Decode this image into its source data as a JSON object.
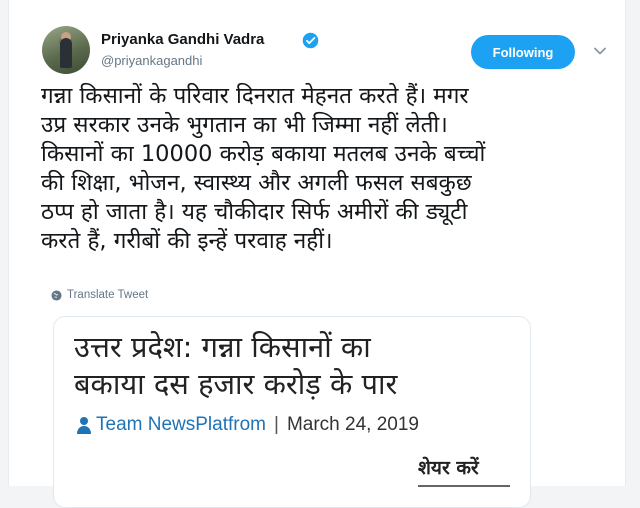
{
  "tweet": {
    "author_name": "Priyanka Gandhi Vadra",
    "handle": "@priyankagandhi",
    "follow_label": "Following",
    "text": "गन्ना किसानों के परिवार दिनरात मेहनत करते हैं। मगर\nउप्र सरकार उनके भुगतान का भी जिम्मा नहीं लेती।\nकिसानों का 10000 करोड़ बकाया मतलब उनके बच्चों\nकी शिक्षा, भोजन, स्वास्थ्य और अगली फसल सबकुछ\nठप्प हो जाता है। यह चौकीदार सिर्फ अमीरों की ड्यूटी\nकरते हैं, गरीबों की इन्हें परवाह नहीं।",
    "translate_label": "Translate Tweet"
  },
  "preview": {
    "headline": "उत्तर प्रदेश: गन्ना किसानों का\nबकाया दस हजार करोड़ के पार",
    "author": "Team NewsPlatfrom",
    "separator": "|",
    "date": "March 24, 2019",
    "share_label": "शेयर करें"
  },
  "colors": {
    "accent": "#1da1f2",
    "link": "#1f73b7",
    "secondary_text": "#657786"
  },
  "icons": [
    "verified-badge-icon",
    "chevron-down-icon",
    "globe-icon",
    "person-icon"
  ]
}
